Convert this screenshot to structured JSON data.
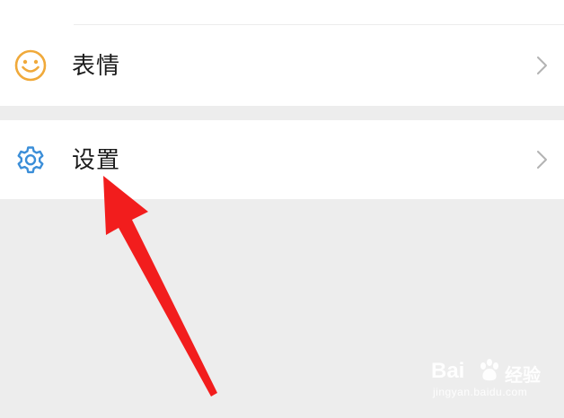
{
  "menu": {
    "items": [
      {
        "label": "表情",
        "icon": "smiley-face-icon",
        "icon_color": "#f0a93a"
      },
      {
        "label": "设置",
        "icon": "gear-icon",
        "icon_color": "#3b8ed8"
      }
    ]
  },
  "annotation": {
    "arrow_color": "#f21d1d",
    "points_to": "设置"
  },
  "watermark": {
    "brand": "Bai",
    "brand_suffix": "经验",
    "url": "jingyan.baidu.com"
  },
  "colors": {
    "background": "#ededed",
    "card": "#ffffff",
    "text": "#1b1b1b",
    "chevron": "#b3b3b3"
  }
}
